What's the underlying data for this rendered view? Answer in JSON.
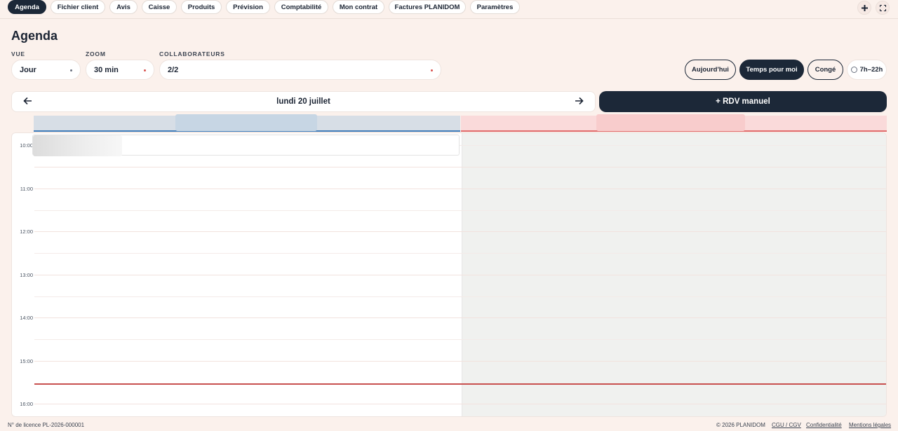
{
  "nav": {
    "tabs": [
      {
        "label": "Agenda",
        "active": true
      },
      {
        "label": "Fichier client"
      },
      {
        "label": "Avis"
      },
      {
        "label": "Caisse"
      },
      {
        "label": "Produits"
      },
      {
        "label": "Prévision"
      },
      {
        "label": "Comptabilité"
      },
      {
        "label": "Mon contrat"
      },
      {
        "label": "Factures PLANIDOM"
      },
      {
        "label": "Paramètres"
      }
    ],
    "add_icon": "plus-icon",
    "fullscreen_icon": "fullscreen-icon"
  },
  "page": {
    "title": "Agenda"
  },
  "filters": {
    "vue_label": "VUE",
    "vue_value": "Jour",
    "zoom_label": "ZOOM",
    "zoom_value": "30 min",
    "collab_label": "COLLABORATEURS",
    "collab_value": "2/2"
  },
  "actions": {
    "today": "Aujourd'hui",
    "time_for_me": "Temps pour moi",
    "leave": "Congé",
    "hours": "7h–22h"
  },
  "datebar": {
    "date": "lundi 20 juillet",
    "prev_icon": "arrow-left-icon",
    "next_icon": "arrow-right-icon"
  },
  "rdv_button": "+ RDV manuel",
  "hours": [
    "10:00",
    "11:00",
    "12:00",
    "13:00",
    "14:00",
    "15:00",
    "16:00"
  ],
  "colors": {
    "dark": "#1c2838",
    "collab1": "#3e7bb8",
    "collab2": "#e06b6b",
    "now": "#c8504f"
  },
  "footer": {
    "license": "N° de licence PL-2026-000001",
    "copyright": "© 2026 PLANIDOM",
    "cgu": "CGU / CGV",
    "privacy": "Confidentialité",
    "legal": "Mentions légales"
  }
}
